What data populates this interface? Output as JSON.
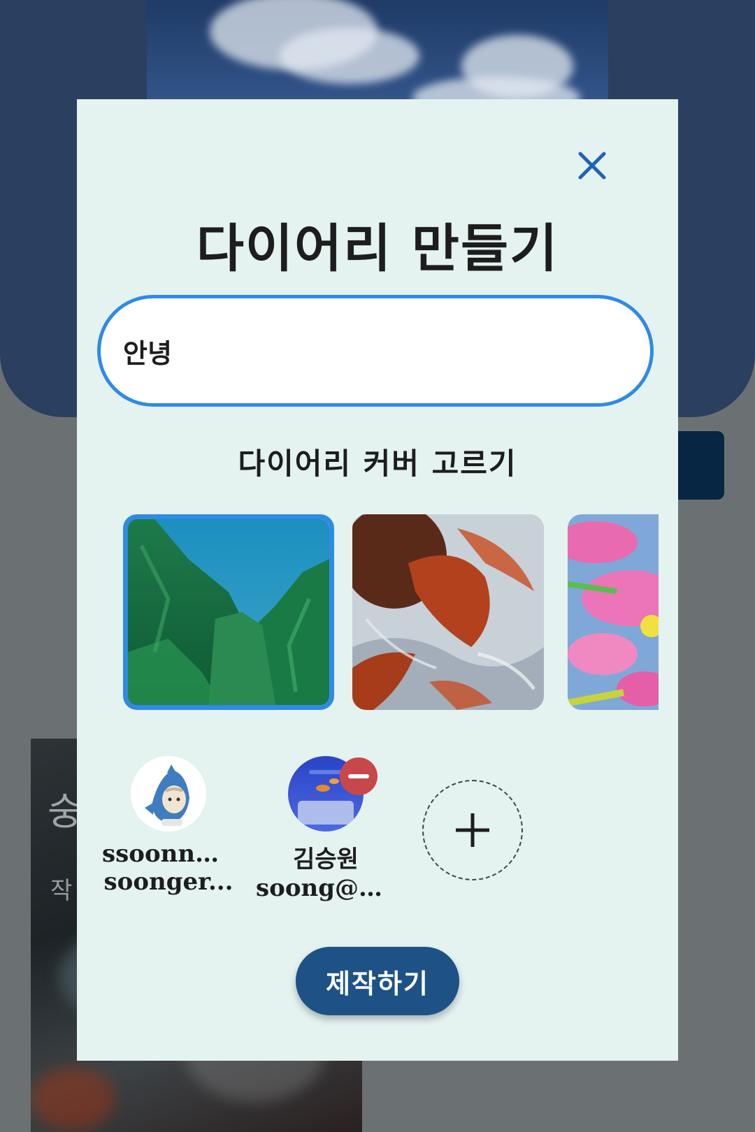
{
  "background": {
    "card_title": "숭",
    "card_subtitle": "작"
  },
  "modal": {
    "title": "다이어리 만들기",
    "close_icon": "close-icon",
    "name_input": {
      "value": "안녕",
      "placeholder": ""
    },
    "cover_label": "다이어리 커버 고르기",
    "covers": [
      {
        "name": "green-cliff-cover",
        "selected": true
      },
      {
        "name": "goldfish-cover",
        "selected": false
      },
      {
        "name": "pink-flowers-cover",
        "selected": false
      }
    ],
    "members": [
      {
        "name": "ssoonng...",
        "email": "soonger...",
        "removable": false
      },
      {
        "name": "김승원",
        "email": "soong@g...",
        "removable": true
      }
    ],
    "add_member_icon": "plus-icon",
    "create_label": "제작하기"
  },
  "colors": {
    "accent": "#2f8ae6",
    "primary_button": "#1e5286",
    "remove_badge": "#c8474a",
    "modal_bg": "#e4f2f0"
  }
}
